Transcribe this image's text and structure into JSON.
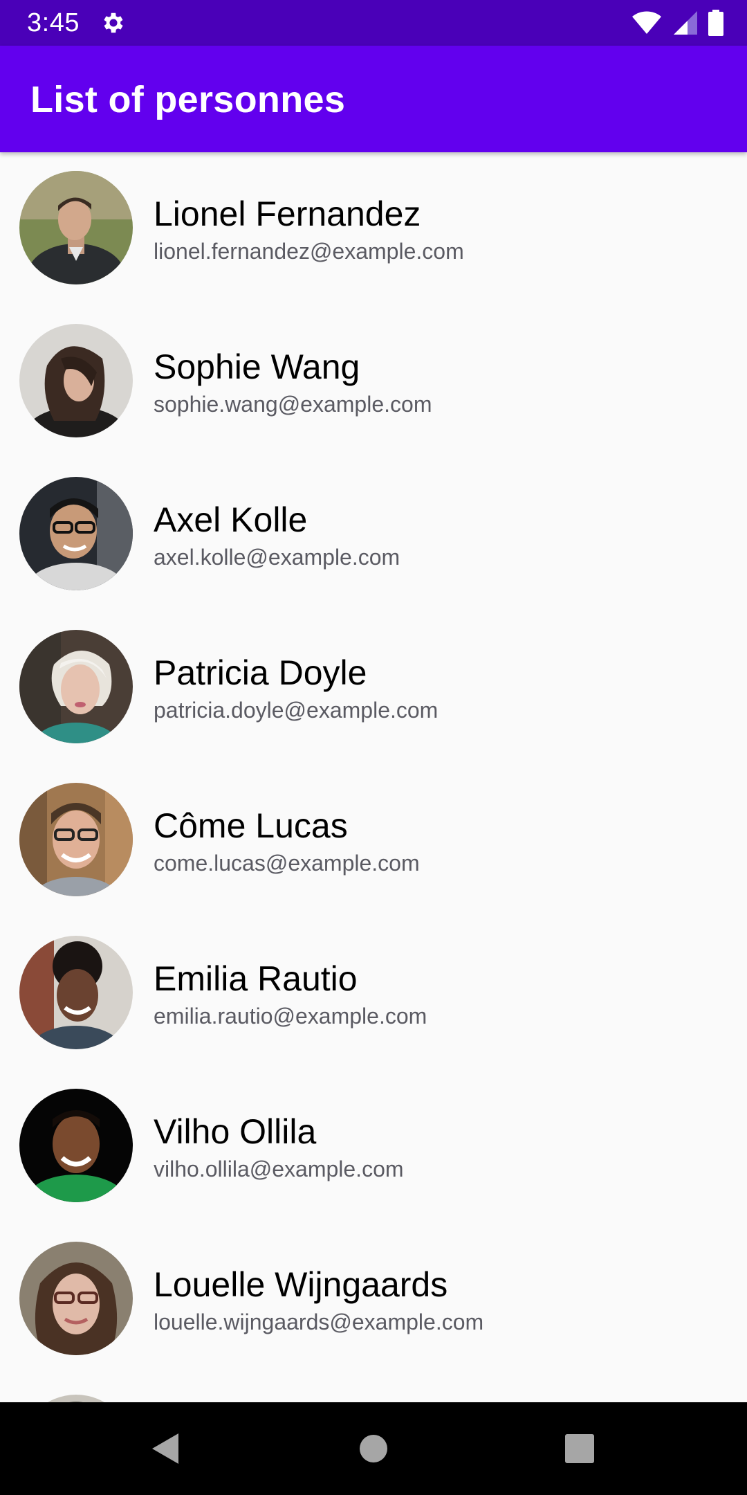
{
  "status_bar": {
    "time": "3:45",
    "icons": [
      "gear-icon",
      "wifi-icon",
      "cellular-signal-icon",
      "battery-icon"
    ]
  },
  "app_bar": {
    "title": "List of personnes",
    "color": "#6200ee"
  },
  "people": [
    {
      "name": "Lionel Fernandez",
      "email": "lionel.fernandez@example.com"
    },
    {
      "name": "Sophie Wang",
      "email": "sophie.wang@example.com"
    },
    {
      "name": "Axel Kolle",
      "email": "axel.kolle@example.com"
    },
    {
      "name": "Patricia Doyle",
      "email": "patricia.doyle@example.com"
    },
    {
      "name": "Côme Lucas",
      "email": "come.lucas@example.com"
    },
    {
      "name": "Emilia Rautio",
      "email": "emilia.rautio@example.com"
    },
    {
      "name": "Vilho Ollila",
      "email": "vilho.ollila@example.com"
    },
    {
      "name": "Louelle Wijngaards",
      "email": "louelle.wijngaards@example.com"
    }
  ],
  "nav_bar": {
    "icons": [
      "back-icon",
      "home-icon",
      "recents-icon"
    ]
  }
}
